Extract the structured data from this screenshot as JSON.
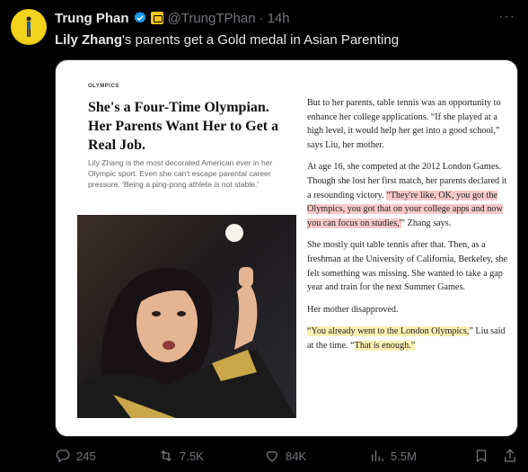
{
  "author": {
    "name": "Trung Phan",
    "handle": "@TrungTPhan",
    "time": "14h"
  },
  "tweet": {
    "text_bold": "Lily Zhang",
    "text_rest": "'s parents get a Gold medal in Asian Parenting"
  },
  "article": {
    "kicker": "OLYMPICS",
    "headline": "She's a Four-Time Olympian. Her Parents Want Her to Get a Real Job.",
    "dek": "Lily Zhang is the most decorated American ever in her Olympic sport. Even she can't escape parental career pressure. 'Being a ping-pong athlete is not stable.'",
    "p1": "But to her parents, table tennis was an opportunity to enhance her college applications. “If she played at a high level, it would help her get into a good school,” says Liu, her mother.",
    "p2_plain": "At age 16, she competed at the 2012 London Games. Though she lost her first match, her parents declared it a resounding victory.",
    "p2_highlight": "“They're like, OK, you got the Olympics, you got that on your college apps and now you can focus on studies,'",
    "p2_tail": "” Zhang says.",
    "p3": "She mostly quit table tennis after that. Then, as a freshman at the University of California, Berkeley, she felt something was missing. She wanted to take a gap year and train for the next Summer Games.",
    "p4": "Her mother disapproved.",
    "p5_highlight1": "“You already went to the London Olympics,",
    "p5_mid": "” Liu said at the time. “",
    "p5_highlight2": "That is enough.”"
  },
  "actions": {
    "replies": "245",
    "reposts": "7.5K",
    "likes": "84K",
    "views": "5.5M"
  },
  "colors": {
    "background": "#000000",
    "verified": "#1d9bf0",
    "affiliate": "#f5c518",
    "muted": "#71767b",
    "highlight_pink": "#f7c9c9",
    "highlight_yellow": "#fbf0b3"
  }
}
